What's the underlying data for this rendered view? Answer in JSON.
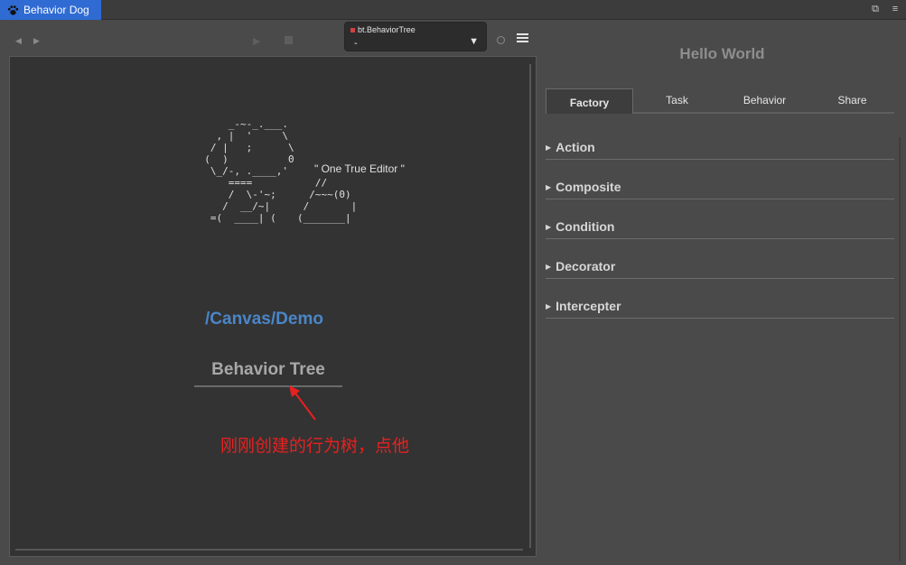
{
  "titlebar": {
    "app_name": "Behavior Dog",
    "restore_glyph": "⧉",
    "menu_glyph": "≡"
  },
  "toolbar": {
    "back_glyph": "◀",
    "forward_glyph": "▶",
    "play_glyph": "▶",
    "tree_selector": {
      "tag": "bt.BehaviorTree",
      "value": "-",
      "caret": "▼"
    }
  },
  "canvas": {
    "ascii_art": "      _-~-_.___.\n    , |  '     \\\n   / |   ;      \\\n  (  )          0\n   \\_/-, .____,'\n      ====\n      /  \\-'~;\n     /  __/~|\n   =(  ____| (",
    "ascii_art_right": "   //\n  /~~~(0)\n /       |\n(_______|",
    "tagline": "\" One True Editor \"",
    "path": "/Canvas/Demo",
    "tree_link": "Behavior Tree",
    "annotation": "刚刚创建的行为树，点他"
  },
  "right_panel": {
    "title": "Hello World",
    "tabs": [
      {
        "label": "Factory",
        "active": true
      },
      {
        "label": "Task",
        "active": false
      },
      {
        "label": "Behavior",
        "active": false
      },
      {
        "label": "Share",
        "active": false
      }
    ],
    "sections": [
      {
        "label": "Action"
      },
      {
        "label": "Composite"
      },
      {
        "label": "Condition"
      },
      {
        "label": "Decorator"
      },
      {
        "label": "Intercepter"
      }
    ],
    "section_glyph": "▶"
  },
  "colors": {
    "accent_blue": "#2f6bd3",
    "path_blue": "#4a86c8",
    "annotation_red": "#e82020"
  }
}
